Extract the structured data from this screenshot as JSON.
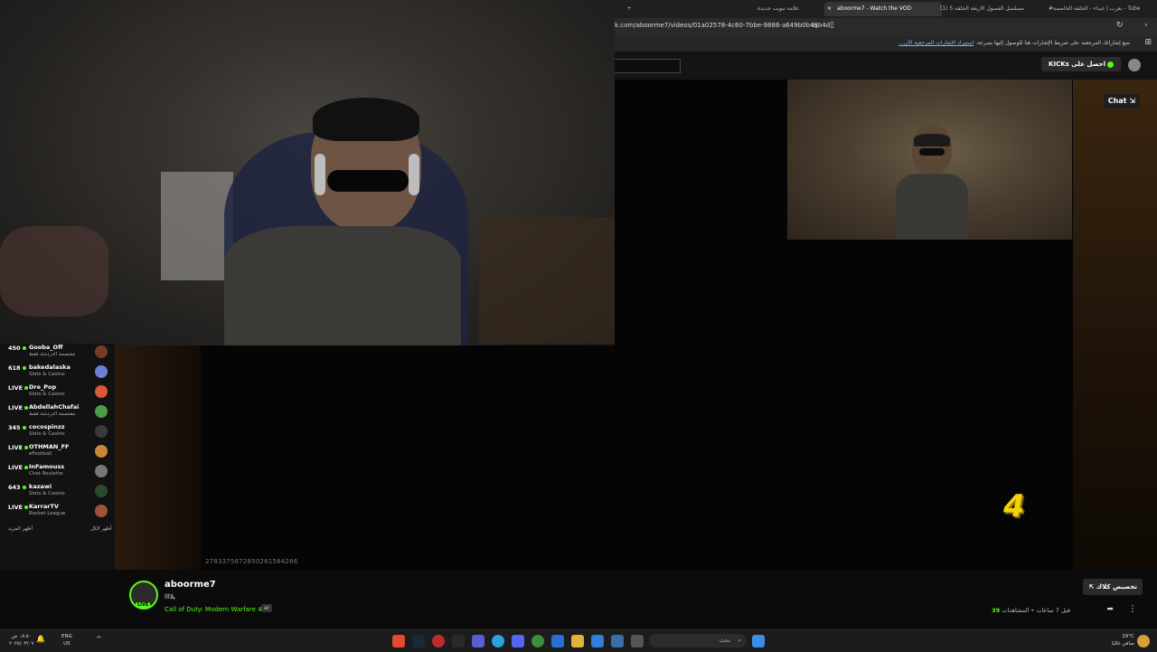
{
  "browser": {
    "tabs": [
      {
        "label": "#يعرب | غيداء - الحلقة الخامسة - Tube"
      },
      {
        "label": "(1) مسلسل الفصول الاربعة الحلقة 5"
      },
      {
        "label": "aboorme7 - Watch the VOD",
        "active": true
      },
      {
        "label": "علامة تبويب جديدة"
      }
    ],
    "url": "k.com/aboorme7/videos/01a02578-4c60-7bbe-9886-a649b0b49b4d",
    "bookmark_message": "ضع إشاراتك المرجعية على شريط الإشارات هنا للوصول إليها بسرعة.",
    "bookmark_link": "استيراد الإشارات المرجعية الآن..."
  },
  "header": {
    "get_kicks": "احصل على KICKs"
  },
  "sidebar": {
    "items": [
      {
        "count": "450",
        "name": "Gooba_Off",
        "category": "مقتصمة الدردشة فقط"
      },
      {
        "count": "618",
        "name": "bakedalaska",
        "category": "Slots & Casino"
      },
      {
        "count": "LIVE",
        "name": "Dre_Pop",
        "category": "Slots & Casino"
      },
      {
        "count": "LIVE",
        "name": "AbdellahChafai",
        "category": "مقتصمة الدردشة فقط"
      },
      {
        "count": "345",
        "name": "cocospinzz",
        "category": "Slots & Casino"
      },
      {
        "count": "LIVE",
        "name": "OTHMAN_FF",
        "category": "eFootball"
      },
      {
        "count": "LIVE",
        "name": "InFamouss",
        "category": "Chat Roulette"
      },
      {
        "count": "643",
        "name": "kazawi",
        "category": "Slots & Casino"
      },
      {
        "count": "LIVE",
        "name": "KarrarTV",
        "category": "Rocket League"
      }
    ],
    "show_more": "أظهر المزيد",
    "show_all": "أظهر الكل"
  },
  "player": {
    "vod_id": "2783375672850261564266",
    "overlay_number": "4",
    "chat_button": "Chat"
  },
  "channel": {
    "name": "aboorme7",
    "title": "يلاااا",
    "game": "Call of Duty: Modern Warfare 4",
    "language": "ar",
    "live_badge": "LIVE",
    "customize_button": "تخصيص كلاك",
    "viewers_label": "المشاهدات",
    "viewer_count": "39",
    "time_ago": "قبل 7 ساعات"
  },
  "taskbar": {
    "search_placeholder": "بحث",
    "time": "٠٨:٥٠ ص",
    "date": "٢٠٢٥/٠٣/٠٩",
    "lang_line1": "ENG",
    "lang_line2": "US",
    "temp": "29°C",
    "weather": "صافي غالبًا"
  },
  "colors": {
    "accent": "#53fc18",
    "overlay_yellow": "#f5d10a"
  }
}
